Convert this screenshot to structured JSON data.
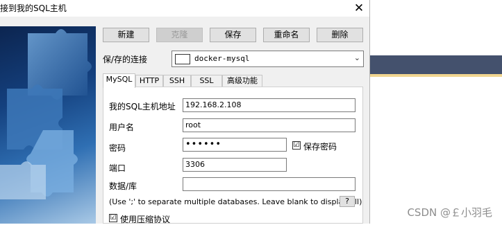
{
  "window": {
    "title": "接到我的SQL主机",
    "close_icon": "close-icon"
  },
  "toolbar": {
    "new_label": "新建",
    "clone_label": "克隆",
    "save_label": "保存",
    "rename_label": "重命名",
    "delete_label": "删除"
  },
  "connection": {
    "label": "保/存的连接",
    "selected": "docker-mysql"
  },
  "tabs": [
    {
      "label": "MySQL",
      "active": true
    },
    {
      "label": "HTTP",
      "active": false
    },
    {
      "label": "SSH",
      "active": false
    },
    {
      "label": "SSL",
      "active": false
    },
    {
      "label": "高级功能",
      "active": false
    }
  ],
  "form": {
    "host_label": "我的SQL主机地址",
    "host_value": "192.168.2.108",
    "user_label": "用户名",
    "user_value": "root",
    "password_label": "密码",
    "password_value": "••••••",
    "save_password_label": "保存密码",
    "save_password_checked": true,
    "port_label": "端口",
    "port_value": "3306",
    "database_label": "数据/库",
    "database_value": "",
    "hint": "(Use ';' to separate multiple databases. Leave blank to display all)",
    "help_label": "?",
    "compression_label": "使用压缩协议",
    "compression_checked": true,
    "check_mark": "☑"
  },
  "watermark": "CSDN @￡小羽毛",
  "colors": {
    "dialog_bg": "#f0f0f0",
    "button_bg": "#e1e1e1",
    "bg_band": "#44516d",
    "bg_line": "#f1d590",
    "puzzle_blue": "#14407e"
  }
}
